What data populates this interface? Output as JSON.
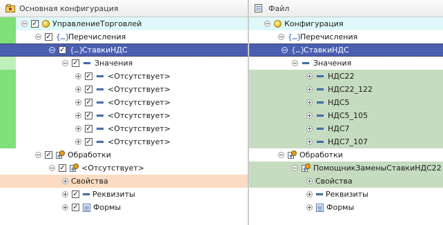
{
  "left_header": {
    "title": "Основная конфигурация",
    "icon": "config-icon"
  },
  "right_header": {
    "title": "Файл",
    "icon": "file-icon"
  },
  "left_tree": [
    {
      "label": "УправлениеТорговлей",
      "icon": "sphere-icon",
      "checkbox": true,
      "expander": "minus",
      "bg": "light-cyan",
      "marker": "bright"
    },
    {
      "label": "Перечисления",
      "icon": "enum-icon",
      "checkbox": true,
      "expander": "minus",
      "marker": "bright"
    },
    {
      "label": "СтавкиНДС",
      "icon": "enum-icon",
      "checkbox": true,
      "expander": "minus",
      "bg": "selected",
      "marker": "none"
    },
    {
      "label": "Значения",
      "icon": "value-icon",
      "checkbox": true,
      "expander": "minus",
      "marker": "light"
    },
    {
      "label": "<Отсутствует>",
      "icon": "value-icon",
      "checkbox": true,
      "expander": "plus",
      "marker": "bright"
    },
    {
      "label": "<Отсутствует>",
      "icon": "value-icon",
      "checkbox": true,
      "expander": "plus",
      "marker": "bright"
    },
    {
      "label": "<Отсутствует>",
      "icon": "value-icon",
      "checkbox": true,
      "expander": "plus",
      "marker": "bright"
    },
    {
      "label": "<Отсутствует>",
      "icon": "value-icon",
      "checkbox": true,
      "expander": "plus",
      "marker": "bright"
    },
    {
      "label": "<Отсутствует>",
      "icon": "value-icon",
      "checkbox": true,
      "expander": "plus",
      "marker": "bright"
    },
    {
      "label": "<Отсутствует>",
      "icon": "value-icon",
      "checkbox": true,
      "expander": "plus",
      "marker": "bright"
    },
    {
      "label": "Обработки",
      "icon": "processing-icon",
      "checkbox": true,
      "expander": "minus"
    },
    {
      "label": "<Отсутствует>",
      "icon": "processing-icon",
      "checkbox": true,
      "expander": "minus"
    },
    {
      "label": "Свойства",
      "icon": "",
      "checkbox": false,
      "expander": "plus",
      "bg": "peach"
    },
    {
      "label": "Реквизиты",
      "icon": "attribute-icon",
      "checkbox": true,
      "expander": "plus"
    },
    {
      "label": "Формы",
      "icon": "form-icon",
      "checkbox": true,
      "expander": "plus"
    }
  ],
  "right_tree": [
    {
      "label": "Конфигурация",
      "icon": "sphere-icon",
      "expander": "minus",
      "bg": "light-cyan"
    },
    {
      "label": "Перечисления",
      "icon": "enum-icon",
      "expander": "minus"
    },
    {
      "label": "СтавкиНДС",
      "icon": "enum-icon",
      "expander": "minus",
      "bg": "selected"
    },
    {
      "label": "Значения",
      "icon": "value-icon",
      "expander": "minus"
    },
    {
      "label": "НДС22",
      "icon": "value-icon",
      "expander": "plus",
      "bg": "green"
    },
    {
      "label": "НДС22_122",
      "icon": "value-icon",
      "expander": "plus",
      "bg": "green"
    },
    {
      "label": "НДС5",
      "icon": "value-icon",
      "expander": "plus",
      "bg": "green"
    },
    {
      "label": "НДС5_105",
      "icon": "value-icon",
      "expander": "plus",
      "bg": "green"
    },
    {
      "label": "НДС7",
      "icon": "value-icon",
      "expander": "plus",
      "bg": "green"
    },
    {
      "label": "НДС7_107",
      "icon": "value-icon",
      "expander": "plus",
      "bg": "green"
    },
    {
      "label": "Обработки",
      "icon": "processing-icon",
      "expander": "minus"
    },
    {
      "label": "ПомощникЗаменыСтавкиНДС22",
      "icon": "processing-icon",
      "expander": "minus",
      "bg": "green"
    },
    {
      "label": "Свойства",
      "icon": "",
      "expander": "plus",
      "bg": "green"
    },
    {
      "label": "Реквизиты",
      "icon": "attribute-icon",
      "expander": "plus"
    },
    {
      "label": "Формы",
      "icon": "form-icon",
      "expander": "plus"
    }
  ],
  "colors": {
    "selected": "#4a5fb0",
    "light_cyan": "#dff9fb",
    "green": "#c6dcc0",
    "peach": "#fbdcc2",
    "marker_bright": "#7fe07a",
    "marker_light": "#bff0bb"
  }
}
